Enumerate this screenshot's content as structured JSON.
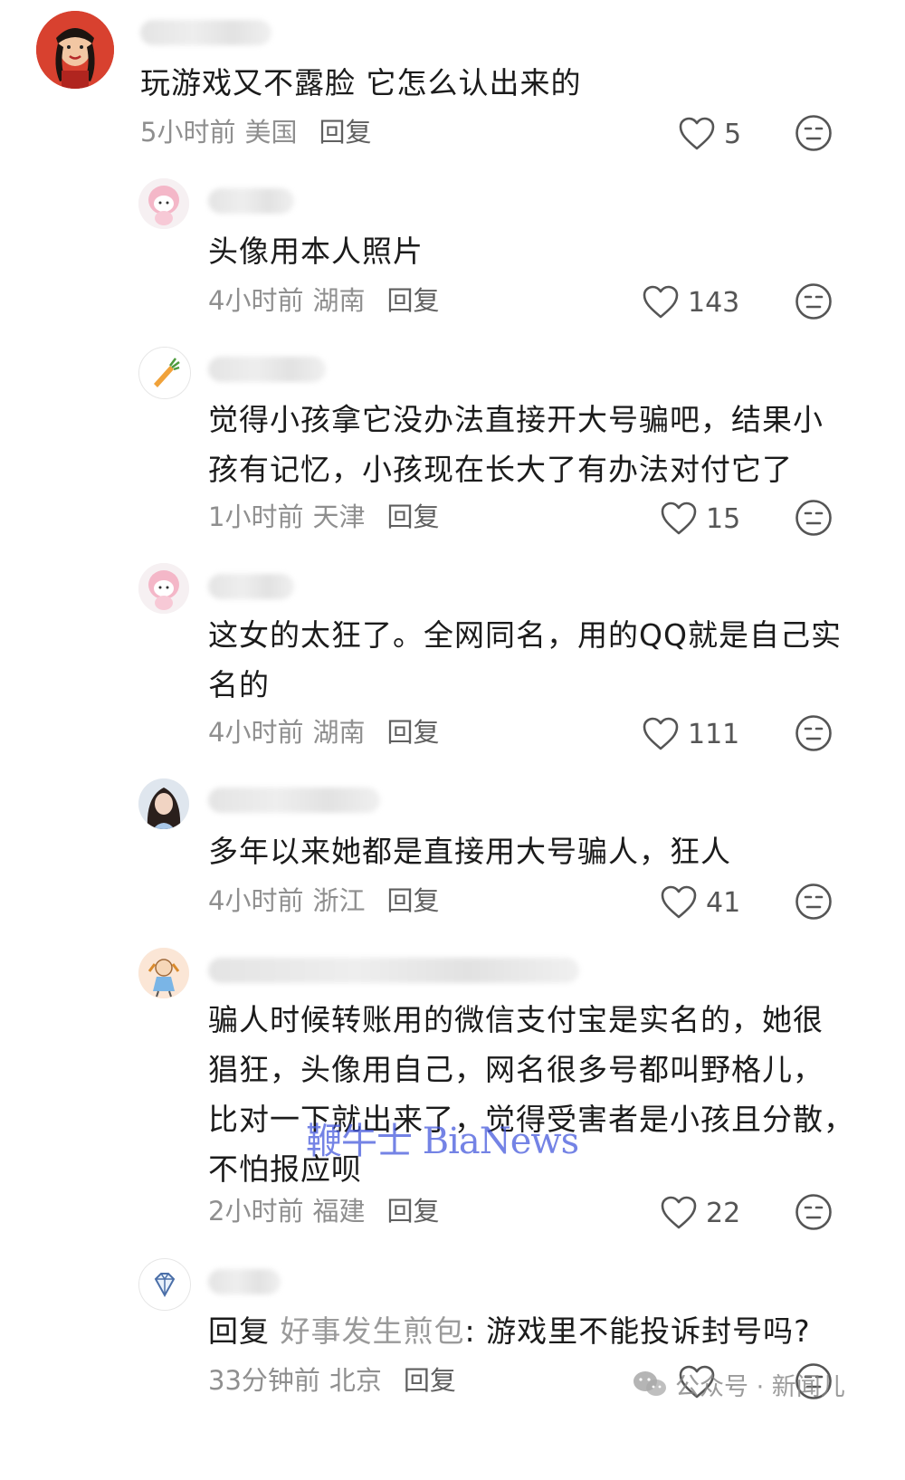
{
  "comments": [
    {
      "text": "玩游戏又不露脸 它怎么认出来的",
      "time": "5小时前",
      "region": "美国",
      "reply": "回复",
      "likes": "5"
    },
    {
      "text": "头像用本人照片",
      "time": "4小时前",
      "region": "湖南",
      "reply": "回复",
      "likes": "143"
    },
    {
      "text_lines": [
        "觉得小孩拿它没办法直接开大号骗吧，结果小",
        "孩有记忆，小孩现在长大了有办法对付它了"
      ],
      "time": "1小时前",
      "region": "天津",
      "reply": "回复",
      "likes": "15"
    },
    {
      "text_lines": [
        "这女的太狂了。全网同名，用的QQ就是自己实",
        "名的"
      ],
      "time": "4小时前",
      "region": "湖南",
      "reply": "回复",
      "likes": "111"
    },
    {
      "text": "多年以来她都是直接用大号骗人，狂人",
      "time": "4小时前",
      "region": "浙江",
      "reply": "回复",
      "likes": "41"
    },
    {
      "text_lines": [
        "骗人时候转账用的微信支付宝是实名的，她很",
        "猖狂，头像用自己，网名很多号都叫野格儿，",
        "比对一下就出来了，觉得受害者是小孩且分散，",
        "不怕报应呗"
      ],
      "time": "2小时前",
      "region": "福建",
      "reply": "回复",
      "likes": "22"
    },
    {
      "reply_prefix": "回复",
      "reply_target": "好事发生煎包",
      "text": ": 游戏里不能投诉封号吗?",
      "time": "33分钟前",
      "region": "北京",
      "reply": "回复"
    }
  ],
  "watermark": "鞭牛士 BiaNews",
  "wechat_watermark": "公众号 · 新闻儿",
  "colors": {
    "meta": "#8f8f8f",
    "reply_target": "#9a9a9a",
    "watermark": "#465adc"
  },
  "icons": [
    "heart-icon",
    "neutral-face-icon",
    "wechat-icon"
  ]
}
